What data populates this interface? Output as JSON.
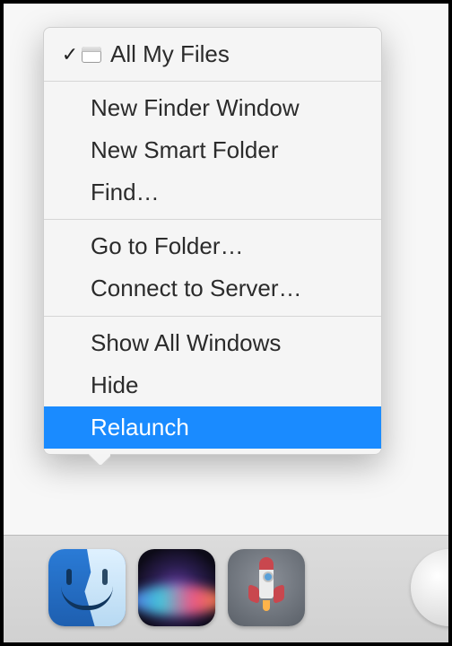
{
  "menu": {
    "items": [
      {
        "label": "All My Files",
        "checked": true,
        "has_icon": true
      },
      {
        "label": "New Finder Window"
      },
      {
        "label": "New Smart Folder"
      },
      {
        "label": "Find…"
      },
      {
        "label": "Go to Folder…"
      },
      {
        "label": "Connect to Server…"
      },
      {
        "label": "Show All Windows"
      },
      {
        "label": "Hide"
      },
      {
        "label": "Relaunch",
        "selected": true
      }
    ],
    "separators_after": [
      0,
      3,
      5
    ]
  },
  "dock": {
    "apps": [
      {
        "name": "Finder",
        "running": true
      },
      {
        "name": "Siri",
        "running": false
      },
      {
        "name": "Launchpad",
        "running": false
      }
    ]
  },
  "colors": {
    "selection": "#1a8bff"
  }
}
